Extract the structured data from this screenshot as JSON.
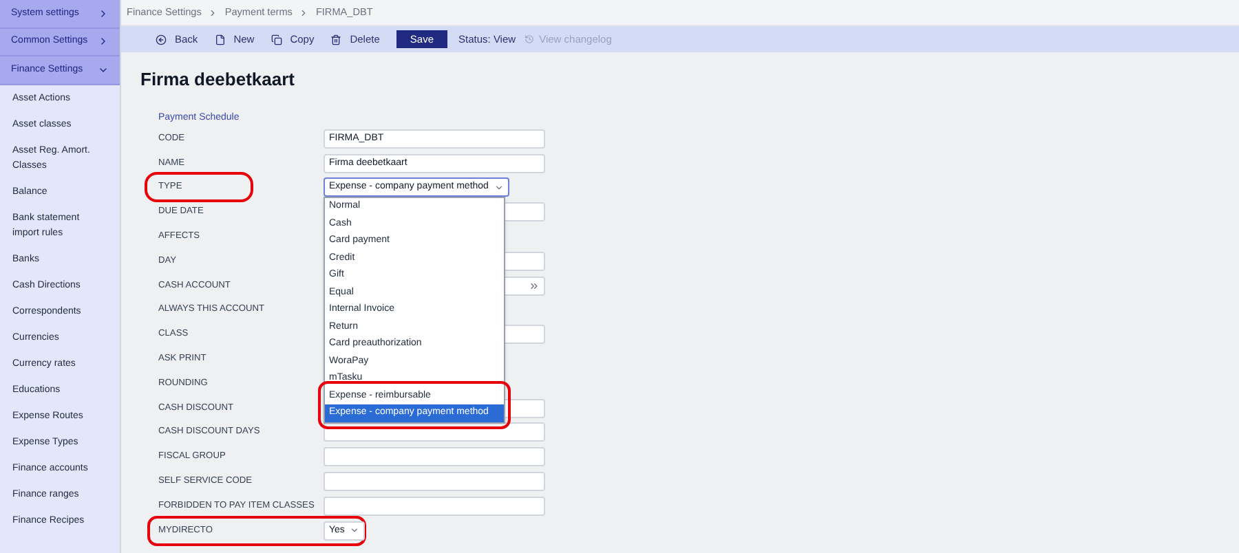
{
  "sidebar": {
    "sections": [
      {
        "label": "System settings",
        "expanded": false
      },
      {
        "label": "Common Settings",
        "expanded": false
      },
      {
        "label": "Finance Settings",
        "expanded": true
      }
    ],
    "items": [
      "Asset Actions",
      "Asset classes",
      "Asset Reg. Amort. Classes",
      "Balance",
      "Bank statement import rules",
      "Banks",
      "Cash Directions",
      "Correspondents",
      "Currencies",
      "Currency rates",
      "Educations",
      "Expense Routes",
      "Expense Types",
      "Finance accounts",
      "Finance ranges",
      "Finance Recipes"
    ]
  },
  "breadcrumb": [
    "Finance Settings",
    "Payment terms",
    "FIRMA_DBT"
  ],
  "toolbar": {
    "buttons": [
      {
        "kind": "back",
        "label": "Back"
      },
      {
        "kind": "new",
        "label": "New"
      },
      {
        "kind": "copy",
        "label": "Copy"
      },
      {
        "kind": "delete",
        "label": "Delete"
      },
      {
        "kind": "save",
        "label": "Save"
      }
    ],
    "status": "Status: View",
    "changelog": {
      "label": "View changelog",
      "disabled": true
    }
  },
  "title": "Firma deebetkaart",
  "section_title": "Payment Schedule",
  "rows": [
    {
      "label": "CODE",
      "kind": "text",
      "value": "FIRMA_DBT"
    },
    {
      "label": "NAME",
      "kind": "text",
      "value": "Firma deebetkaart"
    },
    {
      "label": "TYPE",
      "kind": "select",
      "value": "Expense - company payment method",
      "label_highlighted": true,
      "open": true
    },
    {
      "label": "DUE DATE",
      "kind": "text"
    },
    {
      "label": "AFFECTS",
      "kind": "none"
    },
    {
      "label": "DAY",
      "kind": "text"
    },
    {
      "label": "CASH ACCOUNT",
      "kind": "lookup"
    },
    {
      "label": "ALWAYS THIS ACCOUNT",
      "kind": "none"
    },
    {
      "label": "CLASS",
      "kind": "text"
    },
    {
      "label": "ASK PRINT",
      "kind": "none"
    },
    {
      "label": "ROUNDING",
      "kind": "none"
    },
    {
      "label": "CASH DISCOUNT",
      "kind": "text"
    },
    {
      "label": "CASH DISCOUNT DAYS",
      "kind": "text"
    },
    {
      "label": "FISCAL GROUP",
      "kind": "text"
    },
    {
      "label": "SELF SERVICE CODE",
      "kind": "text"
    },
    {
      "label": "FORBIDDEN TO PAY ITEM CLASSES",
      "kind": "text"
    },
    {
      "label": "MYDIRECTO",
      "kind": "select",
      "value": "Yes",
      "row_highlighted": true,
      "open": false
    }
  ],
  "type_options": [
    {
      "label": "Normal",
      "selected": false,
      "highlighted": false
    },
    {
      "label": "Cash",
      "selected": false,
      "highlighted": false
    },
    {
      "label": "Card payment",
      "selected": false,
      "highlighted": false
    },
    {
      "label": "Credit",
      "selected": false,
      "highlighted": false
    },
    {
      "label": "Gift",
      "selected": false,
      "highlighted": false
    },
    {
      "label": "Equal",
      "selected": false,
      "highlighted": false
    },
    {
      "label": "Internal Invoice",
      "selected": false,
      "highlighted": false
    },
    {
      "label": "Return",
      "selected": false,
      "highlighted": false
    },
    {
      "label": "Card preauthorization",
      "selected": false,
      "highlighted": false
    },
    {
      "label": "WoraPay",
      "selected": false,
      "highlighted": false
    },
    {
      "label": "mTasku",
      "selected": false,
      "highlighted": false
    },
    {
      "label": "Expense - reimbursable",
      "selected": false,
      "highlighted": true
    },
    {
      "label": "Expense - company payment method",
      "selected": true,
      "highlighted": true
    }
  ]
}
